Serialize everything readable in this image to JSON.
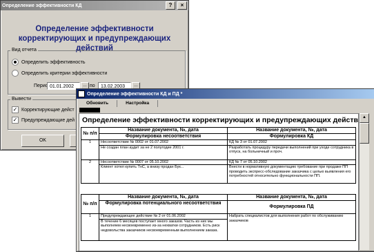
{
  "dialog": {
    "title": "Определение эффективности КД",
    "heading_lines": [
      "Определение эффективности",
      "корректирующих и предупреждающих",
      "действий"
    ],
    "report_type_label": "Вид отчета",
    "radio_efficiency": "Определить эффективность",
    "radio_criteria": "Определить критерии эффективности",
    "period_label": "Период:",
    "date_from": "01.01.2002",
    "to_label": "по",
    "date_to": "13.02.2003",
    "section_label": "Вывести",
    "check_corrective": "Корректирующие дейст",
    "check_preventive": "Предупреждающие дей",
    "ok_label": "OK"
  },
  "report": {
    "title": "Определение эффективности КД и ПД *",
    "toolbar": [
      "Обновить",
      "Настройка"
    ],
    "heading": "Определение эффективности корректирующих и предупреждающих действий",
    "section1": {
      "num_header": "№ п/п",
      "doc_header": "Название документа, №, дата",
      "doc_header2": "Формулировка несоответствия",
      "kd_header": "Название документа, №, дата",
      "kd_header2": "Формулировка КД",
      "rows": [
        {
          "num": "1",
          "doc": "Несоответствие № 0002 от 01.07.2002",
          "text": "Не создан план аудит за не 2 полугодие 2001 г.",
          "kd_doc": "КД №     3 от 01.07.2002",
          "kd_text": "Разработать процедуру передачи выполнений при уходе сотрудника в отпуск, на больничный и проч."
        },
        {
          "num": "2",
          "doc": "Несоответствие № 0007 от 05.10.2002",
          "text": "Клиент хотел купить ТнС, а внизу продан Бук...",
          "kd_doc": "КД №     7 от 05.10.2002",
          "kd_text": "Внести в нормативную документацию требование при продаже ПП проводить экспресс-обследование заказчика с целью выявления его потребностей относительно функциональности ПП."
        }
      ]
    },
    "section2": {
      "num_header": "№ п/п",
      "doc_header": "Название документа, №, дата",
      "doc_header2": "Формулировка потенциального несоответствия",
      "pd_header": "Название документа, №, дата",
      "pd_header2": "Формулировка ПД",
      "rows": [
        {
          "num": "1",
          "doc": "Предупреждающее действие №     2 от 01.06.2002",
          "text": "В течение 6 месяцев поступает много заказов. Часть из них мы выполняем несвоевременно из-за нехватки сотрудников. Есть риск недовольства заказчиков несвоевременным выполнением заказа.",
          "pd_text": "Набрать специалистов для выполнения работ по обслуживанию заказчиков"
        }
      ]
    }
  }
}
